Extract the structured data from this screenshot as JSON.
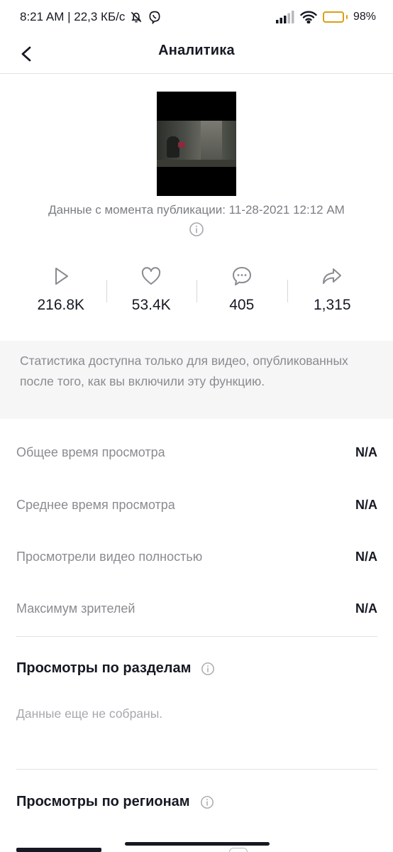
{
  "status_bar": {
    "time_speed": "8:21 AM | 22,3 КБ/с",
    "battery_percent": "98%",
    "icons": [
      "bell-off-icon",
      "viber-icon",
      "signal-icon",
      "wifi-icon",
      "battery-icon"
    ],
    "battery_color": "#f5b01b",
    "battery_level": 0.98
  },
  "header": {
    "title": "Аналитика",
    "back_icon": "chevron-left-icon"
  },
  "video": {
    "published_text": "Данные с момента публикации: 11-28-2021 12:12 AM"
  },
  "stats": [
    {
      "icon": "play-icon",
      "value": "216.8K"
    },
    {
      "icon": "heart-icon",
      "value": "53.4K"
    },
    {
      "icon": "comment-icon",
      "value": "405"
    },
    {
      "icon": "share-icon",
      "value": "1,315"
    }
  ],
  "note": "Статистика доступна только для видео, опубликованных после того, как вы включили эту функцию.",
  "metrics": [
    {
      "label": "Общее время просмотра",
      "value": "N/A"
    },
    {
      "label": "Среднее время просмотра",
      "value": "N/A"
    },
    {
      "label": "Просмотрели видео полностью",
      "value": "N/A"
    },
    {
      "label": "Максимум зрителей",
      "value": "N/A"
    }
  ],
  "sections": {
    "by_section": {
      "title": "Просмотры по разделам",
      "empty": "Данные еще не собраны."
    },
    "by_region": {
      "title": "Просмотры по регионам"
    }
  },
  "colors": {
    "text_primary": "#161823",
    "text_secondary": "#8a8b91",
    "note_background": "#f6f6f6",
    "divider": "#e3e3e4"
  }
}
